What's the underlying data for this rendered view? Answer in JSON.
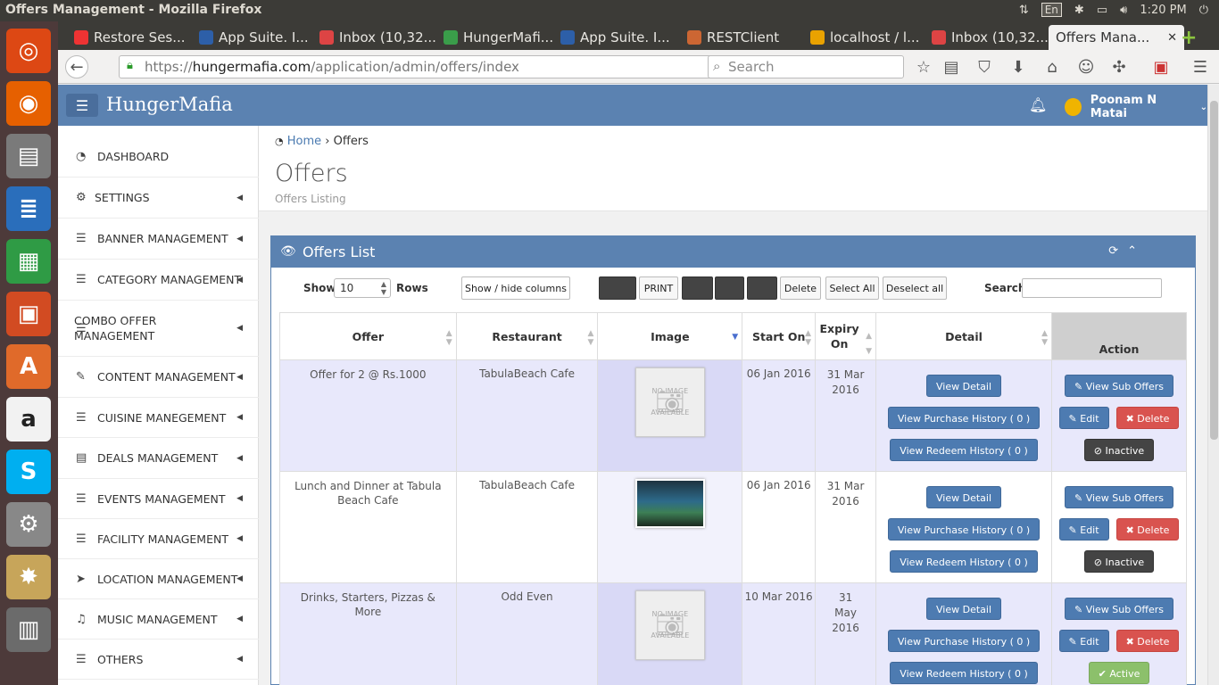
{
  "os": {
    "window_title": "Offers Management - Mozilla Firefox",
    "language": "En",
    "time": "1:20 PM"
  },
  "launcher": [
    {
      "name": "ubuntu-icon",
      "color": "#dd4814",
      "glyph": "◎"
    },
    {
      "name": "firefox-icon",
      "color": "#e66000",
      "glyph": "◉"
    },
    {
      "name": "files-icon",
      "color": "#7a7a7a",
      "glyph": "▤"
    },
    {
      "name": "writer-icon",
      "color": "#2a6ebb",
      "glyph": "≣"
    },
    {
      "name": "calc-icon",
      "color": "#2f9b45",
      "glyph": "▦"
    },
    {
      "name": "impress-icon",
      "color": "#d24b22",
      "glyph": "▣"
    },
    {
      "name": "software-center-icon",
      "color": "#e06a2a",
      "glyph": "A"
    },
    {
      "name": "amazon-icon",
      "color": "#f2f2f2",
      "glyph": "a"
    },
    {
      "name": "skype-icon",
      "color": "#00aff0",
      "glyph": "S"
    },
    {
      "name": "system-settings-icon",
      "color": "#888",
      "glyph": "⚙"
    },
    {
      "name": "workspaces-icon",
      "color": "#c7a55a",
      "glyph": "✸"
    },
    {
      "name": "stacked-apps-icon",
      "color": "#6b6b6b",
      "glyph": "▥"
    }
  ],
  "tabs": [
    {
      "label": "Restore Ses...",
      "fav": "#e33"
    },
    {
      "label": "App Suite. I...",
      "fav": "#2d5fa8"
    },
    {
      "label": "Inbox (10,32...",
      "fav": "#d44"
    },
    {
      "label": "HungerMafi...",
      "fav": "#3a9d4a"
    },
    {
      "label": "App Suite. I...",
      "fav": "#2d5fa8"
    },
    {
      "label": "RESTClient",
      "fav": "#c63"
    },
    {
      "label": "localhost / l...",
      "fav": "#e9a200"
    },
    {
      "label": "Inbox (10,32...",
      "fav": "#d44"
    },
    {
      "label": "Offers Mana...",
      "fav": "#fff"
    }
  ],
  "browser": {
    "url_scheme": "https://",
    "url_host": "hungermafia.com",
    "url_path": "/application/admin/offers/index",
    "search_placeholder": "Search"
  },
  "app": {
    "brand": "HungerMafia",
    "user_name": "Poonam N Matai"
  },
  "sidebar": [
    {
      "label": "DASHBOARD",
      "icon": "dashboard-icon",
      "glyph": "◔",
      "caret": false
    },
    {
      "label": "SETTINGS",
      "icon": "cogs-icon",
      "glyph": "⚙",
      "caret": true
    },
    {
      "label": "BANNER MANAGEMENT",
      "icon": "list-icon",
      "glyph": "☰",
      "caret": true
    },
    {
      "label": "CATEGORY MANAGEMENT",
      "icon": "list-icon",
      "glyph": "☰",
      "caret": true
    },
    {
      "label": "COMBO OFFER MANAGEMENT",
      "icon": "list-icon",
      "glyph": "☰",
      "caret": true
    },
    {
      "label": "CONTENT MANAGEMENT",
      "icon": "pencil-icon",
      "glyph": "✎",
      "caret": true
    },
    {
      "label": "CUISINE MANEGEMENT",
      "icon": "list-icon",
      "glyph": "☰",
      "caret": true
    },
    {
      "label": "DEALS MANAGEMENT",
      "icon": "list-alt-icon",
      "glyph": "▤",
      "caret": true
    },
    {
      "label": "EVENTS MANAGEMENT",
      "icon": "list-icon",
      "glyph": "☰",
      "caret": true
    },
    {
      "label": "FACILITY MANAGEMENT",
      "icon": "list-icon",
      "glyph": "☰",
      "caret": true
    },
    {
      "label": "LOCATION MANAGEMENT",
      "icon": "location-arrow-icon",
      "glyph": "➤",
      "caret": true
    },
    {
      "label": "MUSIC MANAGEMENT",
      "icon": "music-icon",
      "glyph": "♫",
      "caret": true
    },
    {
      "label": "OTHERS",
      "icon": "list-icon",
      "glyph": "☰",
      "caret": true
    }
  ],
  "page": {
    "crumb_home": "Home",
    "crumb_current": "Offers",
    "title": "Offers",
    "subtitle": "Offers Listing"
  },
  "panel": {
    "title": "Offers List",
    "show_label": "Show",
    "rows_value": "10",
    "rows_label": "Rows",
    "colvis_label": "Show / hide columns",
    "print_label": "PRINT",
    "delete_label": "Delete",
    "select_all_label": "Select All",
    "deselect_all_label": "Deselect all",
    "search_label": "Search:"
  },
  "table": {
    "headers": [
      "Offer",
      "Restaurant",
      "Image",
      "Start On",
      "Expiry On",
      "Detail",
      "Action"
    ],
    "rows": [
      {
        "offer": "Offer for 2 @ Rs.1000",
        "restaurant": "TabulaBeach Cafe",
        "image": "placeholder",
        "start": "06 Jan 2016",
        "expiry": "31 Mar 2016",
        "status": "Inactive"
      },
      {
        "offer": "Lunch and Dinner at Tabula Beach Cafe",
        "restaurant": "TabulaBeach Cafe",
        "image": "photo",
        "start": "06 Jan 2016",
        "expiry": "31 Mar 2016",
        "status": "Inactive"
      },
      {
        "offer": "Drinks, Starters, Pizzas & More",
        "restaurant": "Odd Even",
        "image": "placeholder",
        "start": "10 Mar 2016",
        "expiry": "31 May 2016",
        "status": "Active"
      }
    ],
    "no_image_line1": "NO IMAGE",
    "no_image_line2": "AVAILABLE",
    "view_detail": "View Detail",
    "purchase_history": "View Purchase History ( 0 )",
    "redeem_history": "View Redeem History ( 0 )",
    "view_sub_offers": "View Sub Offers",
    "edit": "Edit",
    "delete": "Delete"
  }
}
